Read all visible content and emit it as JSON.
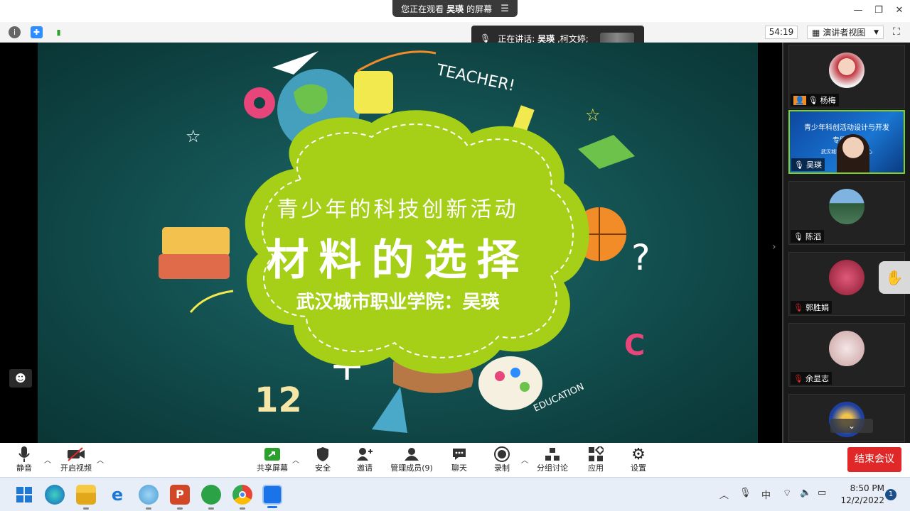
{
  "banner": {
    "prefix": "您正在观看",
    "presenter": "吴瑛",
    "suffix": "的屏幕"
  },
  "toolbar_top": {
    "timer": "54:19",
    "view_label": "演讲者视图"
  },
  "speaking": {
    "prefix": "正在讲话:",
    "name1": "吴瑛",
    "name2": ",柯文婷;"
  },
  "slide": {
    "subtitle": "青少年的科技创新活动",
    "title": "材料的选择",
    "institution": "武汉城市职业学院：吴瑛",
    "doodle_word_top": "TEACHER!",
    "doodle_word_bottom": "EDUCATION",
    "doodle_numbers": "12"
  },
  "participants": [
    {
      "name": "杨梅",
      "mic": "on"
    },
    {
      "name": "吴瑛",
      "mic": "on",
      "thumb_line1": "青少年科创活动设计与开发",
      "thumb_line2": "专题研讨",
      "thumb_line3": "武汉城市职业学院  中心"
    },
    {
      "name": "陈滔",
      "mic": "on"
    },
    {
      "name": "郭胜娟",
      "mic": "muted"
    },
    {
      "name": "余显志",
      "mic": "muted"
    },
    {
      "name": ""
    }
  ],
  "bottom_toolbar": {
    "mute": "静音",
    "video": "开启视频",
    "share": "共享屏幕",
    "security": "安全",
    "invite": "邀请",
    "manage": "管理成员(9)",
    "chat": "聊天",
    "record": "录制",
    "breakout": "分组讨论",
    "apps": "应用",
    "settings": "设置",
    "end": "结束会议"
  },
  "taskbar": {
    "time": "8:50 PM",
    "date": "12/2/2022",
    "ime": "中",
    "notifications": "1"
  },
  "colors": {
    "end_red": "#e02828",
    "blob_green": "#a5d017",
    "slide_teal": "#0f4444",
    "active_border": "#7ed321"
  }
}
